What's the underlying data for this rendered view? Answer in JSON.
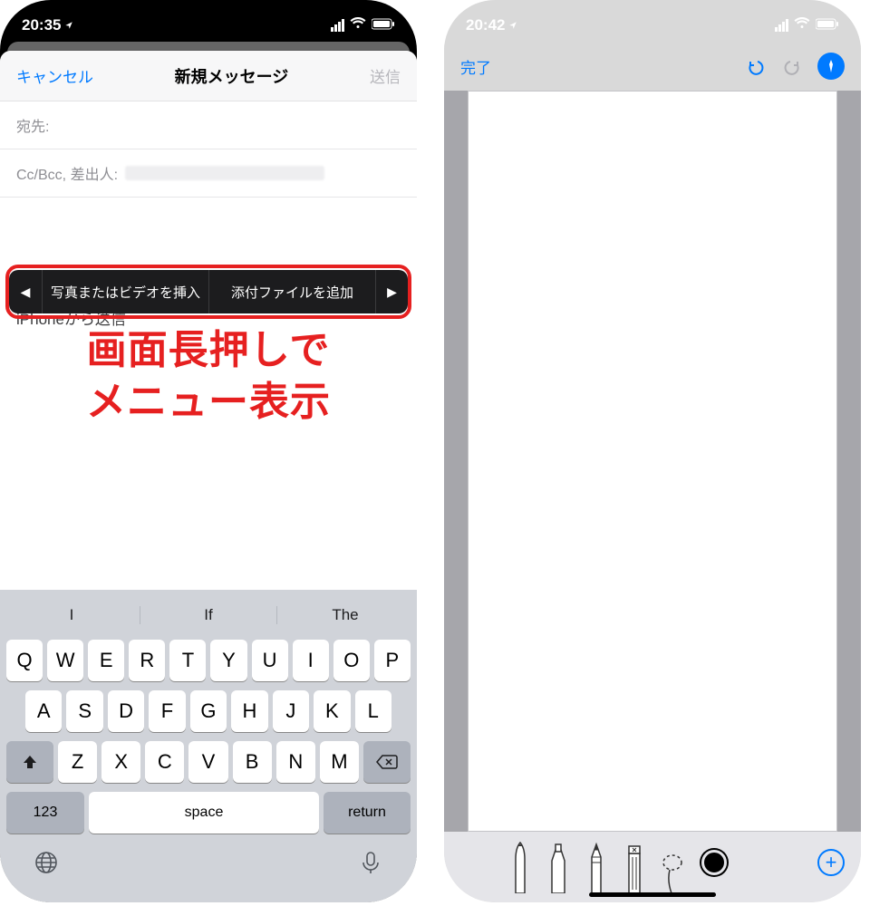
{
  "left": {
    "status": {
      "time": "20:35"
    },
    "mail": {
      "cancel": "キャンセル",
      "title": "新規メッセージ",
      "send": "送信",
      "to_label": "宛先:",
      "cc_label": "Cc/Bcc, 差出人:",
      "signature": "iPhoneから送信"
    },
    "menu": {
      "insert_media": "写真またはビデオを挿入",
      "add_attachment": "添付ファイルを追加"
    },
    "annotation": {
      "line1": "画面長押しで",
      "line2": "メニュー表示"
    },
    "keyboard": {
      "suggest": [
        "I",
        "If",
        "The"
      ],
      "row1": [
        "Q",
        "W",
        "E",
        "R",
        "T",
        "Y",
        "U",
        "I",
        "O",
        "P"
      ],
      "row2": [
        "A",
        "S",
        "D",
        "F",
        "G",
        "H",
        "J",
        "K",
        "L"
      ],
      "row3": [
        "Z",
        "X",
        "C",
        "V",
        "B",
        "N",
        "M"
      ],
      "k123": "123",
      "space": "space",
      "return": "return"
    }
  },
  "right": {
    "status": {
      "time": "20:42"
    },
    "markup": {
      "done": "完了"
    }
  }
}
